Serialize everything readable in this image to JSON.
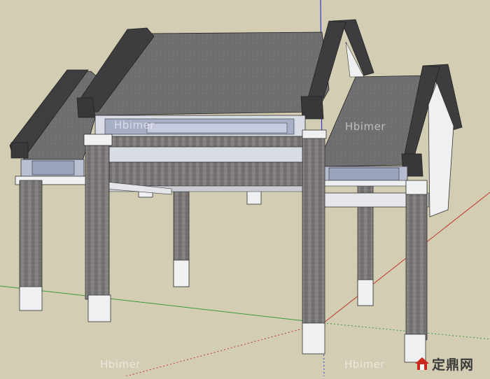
{
  "watermarks": {
    "brand": "Hbimer",
    "logo_text": "定鼎网"
  },
  "colors": {
    "background": "#d3cdb4",
    "roof_tile": "#6f6f72",
    "roof_ridge": "#3b3b3d",
    "brick": "#7a7676",
    "plaster": "#e9ebef",
    "axis_red": "#c0392b",
    "axis_green": "#3a9a3a",
    "axis_blue": "#2d3ec7",
    "logo_red": "#c8281e"
  },
  "scene": {
    "description_icon": "pavilion-3d-model-icon"
  }
}
